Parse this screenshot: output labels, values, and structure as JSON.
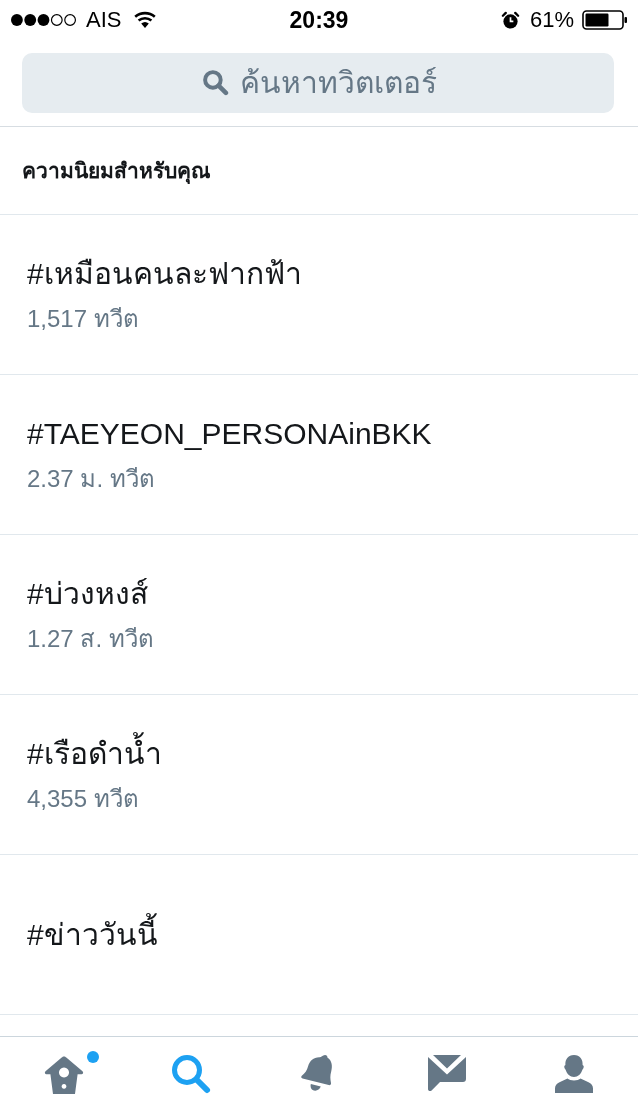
{
  "status_bar": {
    "carrier": "AIS",
    "time": "20:39",
    "battery": "61%"
  },
  "search": {
    "placeholder": "ค้นหาทวิตเตอร์"
  },
  "section_title": "ความนิยมสำหรับคุณ",
  "trends": [
    {
      "name": "#เหมือนคนละฟากฟ้า",
      "count": "1,517 ทวีต"
    },
    {
      "name": "#TAEYEON_PERSONAinBKK",
      "count": "2.37 ม. ทวีต"
    },
    {
      "name": "#บ่วงหงส์",
      "count": "1.27 ส. ทวีต"
    },
    {
      "name": "#เรือดำน้ำ",
      "count": "4,355 ทวีต"
    },
    {
      "name": "#ข่าววันนี้"
    }
  ],
  "tab_bar": {
    "tabs": [
      {
        "kind": "home",
        "selected": false,
        "badge": true
      },
      {
        "kind": "search",
        "selected": true,
        "badge": false
      },
      {
        "kind": "notifications",
        "selected": false,
        "badge": false
      },
      {
        "kind": "messages",
        "selected": false,
        "badge": false
      },
      {
        "kind": "profile",
        "selected": false,
        "badge": false
      }
    ]
  }
}
